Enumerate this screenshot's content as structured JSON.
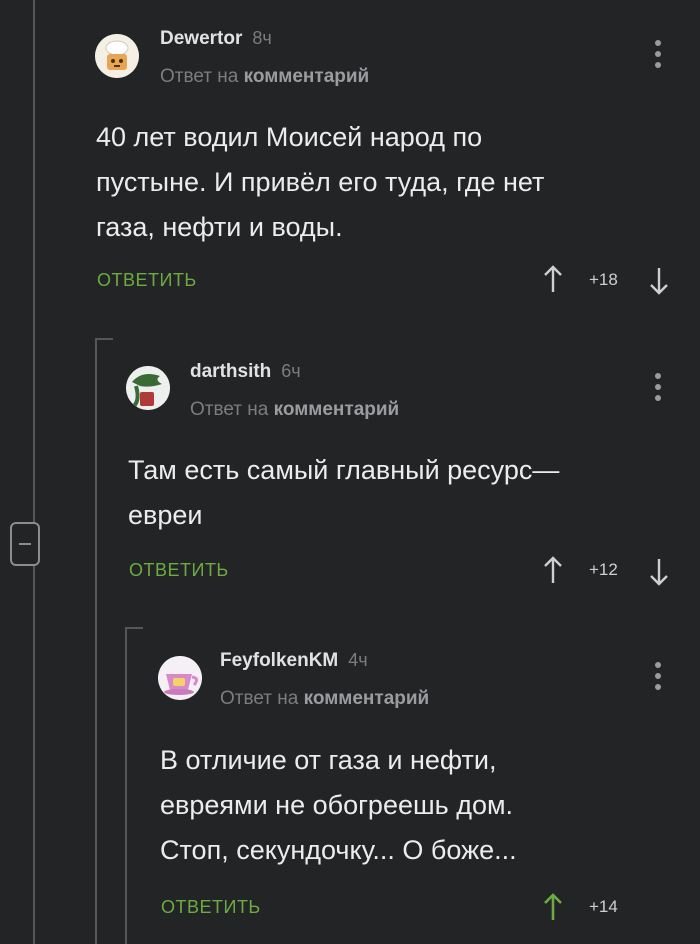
{
  "thread": {
    "comments": [
      {
        "username": "Dewertor",
        "time": "8ч",
        "reply_prefix": "Ответ на",
        "reply_target": "комментарий",
        "body_lines": [
          "40 лет водил Моисей народ по",
          "пустыне. И привёл его туда, где нет",
          "газа, нефти и воды."
        ],
        "reply_label": "ОТВЕТИТЬ",
        "rating": "+18"
      },
      {
        "username": "darthsith",
        "time": "6ч",
        "reply_prefix": "Ответ на",
        "reply_target": "комментарий",
        "body_lines": [
          "Там есть самый главный ресурс—",
          "евреи"
        ],
        "reply_label": "ОТВЕТИТЬ",
        "rating": "+12"
      },
      {
        "username": "FeyfolkenKM",
        "time": "4ч",
        "reply_prefix": "Ответ на",
        "reply_target": "комментарий",
        "body_lines": [
          "В отличие от газа и нефти,",
          "евреями не обогреешь дом.",
          "Стоп, секундочку... О боже..."
        ],
        "reply_label": "ОТВЕТИТЬ",
        "rating": "+14"
      }
    ]
  },
  "colors": {
    "background": "#232426",
    "accent_green": "#6cab43",
    "muted_text": "#7b7d80",
    "rail": "#55575a"
  },
  "icons": {
    "vote_up": "arrow-up-icon",
    "vote_down": "arrow-down-icon",
    "more": "more-vertical-icon",
    "collapse": "collapse-minus-icon"
  }
}
